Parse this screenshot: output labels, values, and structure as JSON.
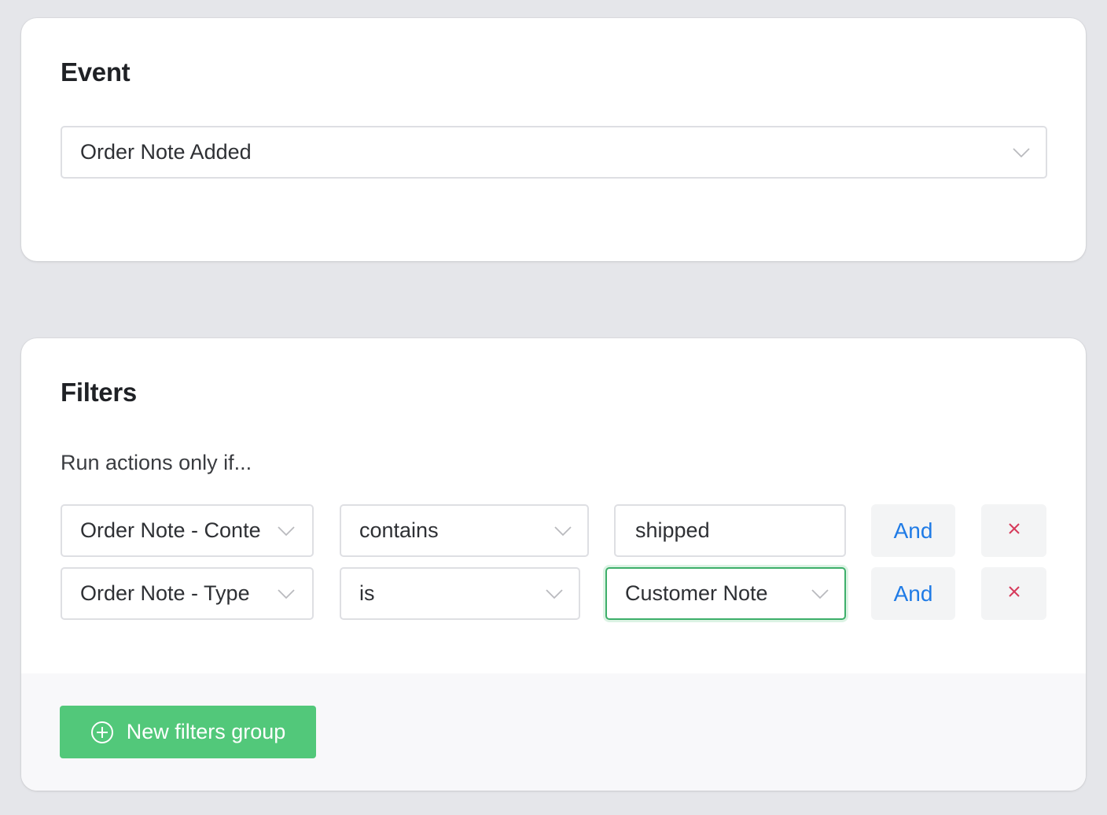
{
  "event_section": {
    "title": "Event",
    "selected_event": "Order Note Added"
  },
  "filters_section": {
    "title": "Filters",
    "subtitle": "Run actions only if...",
    "rows": [
      {
        "field": "Order Note - Conte",
        "operator": "contains",
        "value": "shipped",
        "value_type": "text-input",
        "connector_label": "And",
        "remove_icon": "close-icon"
      },
      {
        "field": "Order Note - Type",
        "operator": "is",
        "value": "Customer Note",
        "value_type": "select",
        "connector_label": "And",
        "remove_icon": "close-icon"
      }
    ],
    "new_group_button": {
      "label": "New filters group",
      "icon": "plus-circle-icon"
    }
  },
  "colors": {
    "accent_blue": "#1f7be6",
    "danger_red": "#d63a5b",
    "success_green": "#52c87a",
    "focus_green": "#3daf6a"
  }
}
